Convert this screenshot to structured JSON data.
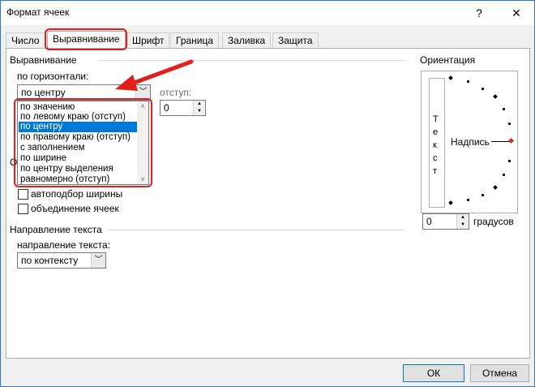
{
  "window": {
    "title": "Формат ячеек",
    "help_label": "?",
    "close_label": "✕"
  },
  "tabs": [
    "Число",
    "Выравнивание",
    "Шрифт",
    "Граница",
    "Заливка",
    "Защита"
  ],
  "alignment": {
    "group_label": "Выравнивание",
    "horizontal_label": "по горизонтали:",
    "horizontal_value": "по центру",
    "indent_label": "отступ:",
    "indent_value": "0",
    "options": [
      "по значению",
      "по левому краю (отступ)",
      "по центру",
      "по правому краю (отступ)",
      "с заполнением",
      "по ширине",
      "по центру выделения",
      "равномерно (отступ)"
    ],
    "selected_index": 2
  },
  "display": {
    "group_label_partial": "О",
    "autofit_label": "автоподбор ширины",
    "merge_label": "объединение ячеек",
    "autofit_checked": false,
    "merge_checked": false
  },
  "direction": {
    "group_label": "Направление текста",
    "direction_label": "направление текста:",
    "direction_value": "по контексту"
  },
  "orientation": {
    "group_label": "Ориентация",
    "vertical_text": [
      "Т",
      "е",
      "к",
      "с",
      "т"
    ],
    "label_text": "Надпись",
    "degrees_value": "0",
    "degrees_label": "градусов"
  },
  "footer": {
    "ok_label": "ОК",
    "cancel_label": "Отмена"
  },
  "colors": {
    "annotation_red": "#e0201c",
    "selection_blue": "#0078d7"
  }
}
